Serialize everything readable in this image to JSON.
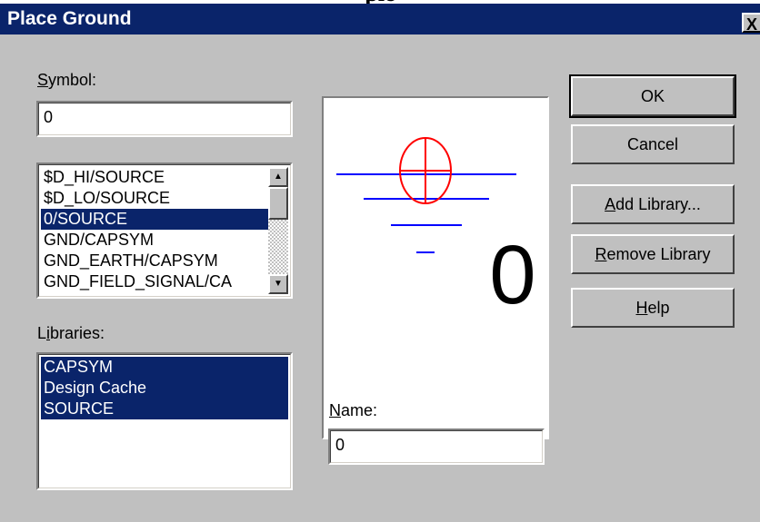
{
  "page_heading": "ple",
  "dialog": {
    "title": "Place Ground",
    "close_label": "X"
  },
  "symbol": {
    "label_first": "S",
    "label_rest": "ymbol:",
    "value": "0"
  },
  "symbol_list": {
    "items": [
      "$D_HI/SOURCE",
      "$D_LO/SOURCE",
      "0/SOURCE",
      "GND/CAPSYM",
      "GND_EARTH/CAPSYM",
      "GND_FIELD_SIGNAL/CA"
    ],
    "selected": "0/SOURCE"
  },
  "libraries": {
    "label_first": "L",
    "label_mid": "i",
    "label_rest": "braries:",
    "items": [
      "CAPSYM",
      "Design Cache",
      "SOURCE"
    ]
  },
  "name": {
    "label_first": "N",
    "label_rest": "ame:",
    "value": "0"
  },
  "preview": {
    "symbol_text": "0",
    "line_color": "#0000ff",
    "circle_color": "#ff0000"
  },
  "buttons": {
    "ok": "OK",
    "cancel": "Cancel",
    "add_library_first": "A",
    "add_library_rest": "dd Library...",
    "remove_library_first": "R",
    "remove_library_rest": "emove Library",
    "help_first": "H",
    "help_rest": "elp"
  },
  "colors": {
    "titlebar": "#0a246a",
    "selection": "#0a246a",
    "face": "#c0c0c0"
  }
}
